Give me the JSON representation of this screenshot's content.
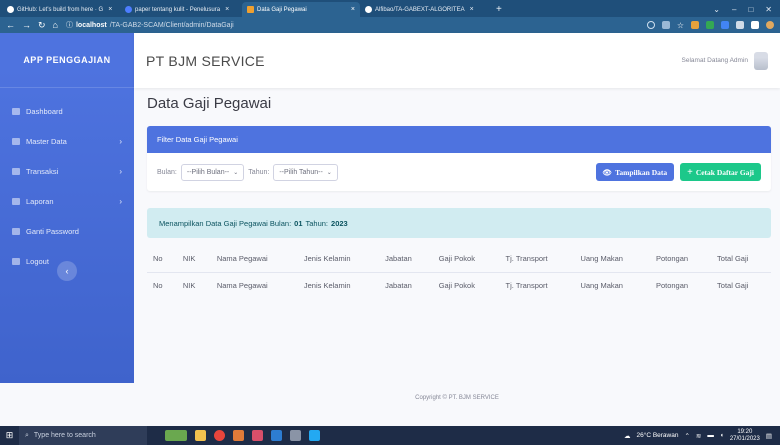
{
  "browser": {
    "tabs": [
      {
        "label": "GitHub: Let's build from here · G",
        "active": false
      },
      {
        "label": "paper tentang kulit - Penelusura",
        "active": false
      },
      {
        "label": "Data Gaji Pegawai",
        "active": true
      },
      {
        "label": "Alfibao/TA-GABEXT-ALGORITEA",
        "active": false
      }
    ],
    "new_tab": "+",
    "url_host": "localhost",
    "url_path": "/TA-GAB2-SCAM/Client/admin/DataGaji"
  },
  "sidebar": {
    "brand": "APP PENGGAJIAN",
    "items": [
      {
        "label": "Dashboard",
        "has_chevron": false
      },
      {
        "label": "Master Data",
        "has_chevron": true
      },
      {
        "label": "Transaksi",
        "has_chevron": true
      },
      {
        "label": "Laporan",
        "has_chevron": true
      },
      {
        "label": "Ganti Password",
        "has_chevron": false
      },
      {
        "label": "Logout",
        "has_chevron": false
      }
    ],
    "toggle_icon": "chevron-left-icon"
  },
  "topbar": {
    "company": "PT BJM SERVICE",
    "greeting": "Selamat Datang Admin"
  },
  "page": {
    "title": "Data Gaji Pegawai",
    "filter_card_title": "Filter Data Gaji Pegawai",
    "bulan_label": "Bulan:",
    "bulan_value": "--Pilih Bulan--",
    "tahun_label": "Tahun:",
    "tahun_value": "--Pilih Tahun--",
    "show_button": "Tampilkan Data",
    "print_button": "Cetak Daftar Gaji",
    "alert_prefix": "Menampilkan Data Gaji Pegawai Bulan:",
    "alert_month": "01",
    "alert_mid": "Tahun:",
    "alert_year": "2023"
  },
  "table": {
    "headers": [
      "No",
      "NIK",
      "Nama Pegawai",
      "Jenis Kelamin",
      "Jabatan",
      "Gaji Pokok",
      "Tj. Transport",
      "Uang Makan",
      "Potongan",
      "Total Gaji"
    ],
    "rows": [
      [
        "No",
        "NIK",
        "Nama Pegawai",
        "Jenis Kelamin",
        "Jabatan",
        "Gaji Pokok",
        "Tj. Transport",
        "Uang Makan",
        "Potongan",
        "Total Gaji"
      ]
    ]
  },
  "footer": "Copyright © PT. BJM SERVICE",
  "taskbar": {
    "search_placeholder": "Type here to search",
    "weather": "26°C Berawan",
    "time": "19:20",
    "date": "27/01/2023"
  },
  "colors": {
    "primary": "#4e73df",
    "success": "#1cc88a",
    "info_bg": "#d1ecf1"
  }
}
